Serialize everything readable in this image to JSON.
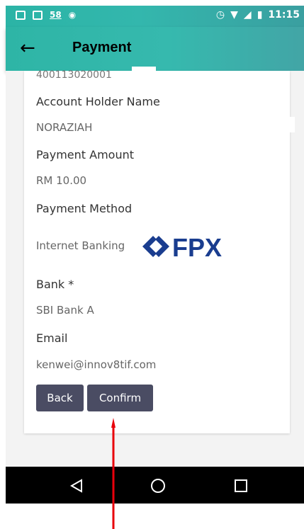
{
  "status_bar": {
    "notification_count": "58",
    "time": "11:15"
  },
  "app_bar": {
    "title": "Payment"
  },
  "form": {
    "account_number_partial": "400113020001",
    "account_holder_label": "Account Holder Name",
    "account_holder_value": "NORAZIAH",
    "payment_amount_label": "Payment Amount",
    "payment_amount_value": "RM 10.00",
    "payment_method_label": "Payment Method",
    "payment_method_value": "Internet Banking",
    "payment_method_logo_text": "FPX",
    "bank_label": "Bank *",
    "bank_value": "SBI Bank A",
    "email_label": "Email",
    "email_value": "kenwei@innov8tif.com"
  },
  "buttons": {
    "back_label": "Back",
    "confirm_label": "Confirm"
  },
  "colors": {
    "app_bar": "#33b7ad",
    "button": "#4a4c63",
    "annotation_arrow": "#e8000b",
    "fpx_blue": "#1a3d8f"
  }
}
